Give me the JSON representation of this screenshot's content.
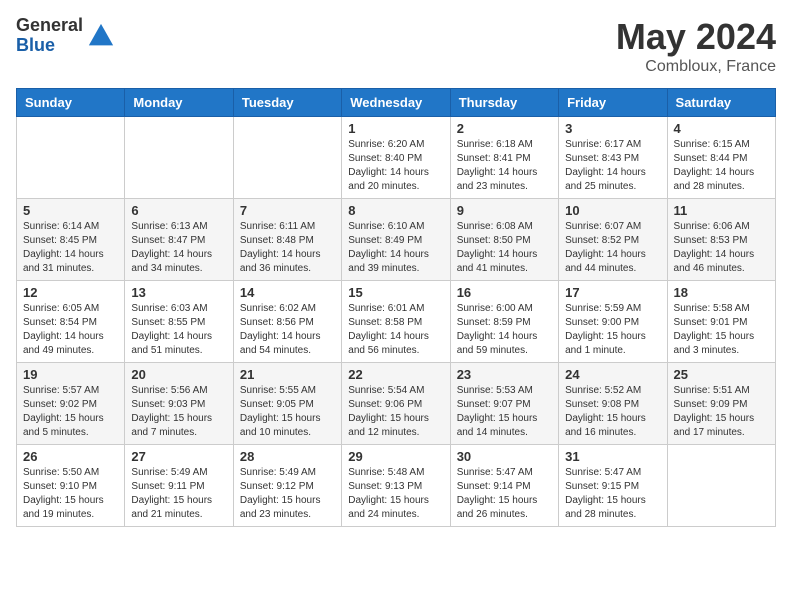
{
  "logo": {
    "general": "General",
    "blue": "Blue"
  },
  "title": "May 2024",
  "location": "Combloux, France",
  "days_of_week": [
    "Sunday",
    "Monday",
    "Tuesday",
    "Wednesday",
    "Thursday",
    "Friday",
    "Saturday"
  ],
  "weeks": [
    [
      {
        "day": "",
        "info": ""
      },
      {
        "day": "",
        "info": ""
      },
      {
        "day": "",
        "info": ""
      },
      {
        "day": "1",
        "info": "Sunrise: 6:20 AM\nSunset: 8:40 PM\nDaylight: 14 hours\nand 20 minutes."
      },
      {
        "day": "2",
        "info": "Sunrise: 6:18 AM\nSunset: 8:41 PM\nDaylight: 14 hours\nand 23 minutes."
      },
      {
        "day": "3",
        "info": "Sunrise: 6:17 AM\nSunset: 8:43 PM\nDaylight: 14 hours\nand 25 minutes."
      },
      {
        "day": "4",
        "info": "Sunrise: 6:15 AM\nSunset: 8:44 PM\nDaylight: 14 hours\nand 28 minutes."
      }
    ],
    [
      {
        "day": "5",
        "info": "Sunrise: 6:14 AM\nSunset: 8:45 PM\nDaylight: 14 hours\nand 31 minutes."
      },
      {
        "day": "6",
        "info": "Sunrise: 6:13 AM\nSunset: 8:47 PM\nDaylight: 14 hours\nand 34 minutes."
      },
      {
        "day": "7",
        "info": "Sunrise: 6:11 AM\nSunset: 8:48 PM\nDaylight: 14 hours\nand 36 minutes."
      },
      {
        "day": "8",
        "info": "Sunrise: 6:10 AM\nSunset: 8:49 PM\nDaylight: 14 hours\nand 39 minutes."
      },
      {
        "day": "9",
        "info": "Sunrise: 6:08 AM\nSunset: 8:50 PM\nDaylight: 14 hours\nand 41 minutes."
      },
      {
        "day": "10",
        "info": "Sunrise: 6:07 AM\nSunset: 8:52 PM\nDaylight: 14 hours\nand 44 minutes."
      },
      {
        "day": "11",
        "info": "Sunrise: 6:06 AM\nSunset: 8:53 PM\nDaylight: 14 hours\nand 46 minutes."
      }
    ],
    [
      {
        "day": "12",
        "info": "Sunrise: 6:05 AM\nSunset: 8:54 PM\nDaylight: 14 hours\nand 49 minutes."
      },
      {
        "day": "13",
        "info": "Sunrise: 6:03 AM\nSunset: 8:55 PM\nDaylight: 14 hours\nand 51 minutes."
      },
      {
        "day": "14",
        "info": "Sunrise: 6:02 AM\nSunset: 8:56 PM\nDaylight: 14 hours\nand 54 minutes."
      },
      {
        "day": "15",
        "info": "Sunrise: 6:01 AM\nSunset: 8:58 PM\nDaylight: 14 hours\nand 56 minutes."
      },
      {
        "day": "16",
        "info": "Sunrise: 6:00 AM\nSunset: 8:59 PM\nDaylight: 14 hours\nand 59 minutes."
      },
      {
        "day": "17",
        "info": "Sunrise: 5:59 AM\nSunset: 9:00 PM\nDaylight: 15 hours\nand 1 minute."
      },
      {
        "day": "18",
        "info": "Sunrise: 5:58 AM\nSunset: 9:01 PM\nDaylight: 15 hours\nand 3 minutes."
      }
    ],
    [
      {
        "day": "19",
        "info": "Sunrise: 5:57 AM\nSunset: 9:02 PM\nDaylight: 15 hours\nand 5 minutes."
      },
      {
        "day": "20",
        "info": "Sunrise: 5:56 AM\nSunset: 9:03 PM\nDaylight: 15 hours\nand 7 minutes."
      },
      {
        "day": "21",
        "info": "Sunrise: 5:55 AM\nSunset: 9:05 PM\nDaylight: 15 hours\nand 10 minutes."
      },
      {
        "day": "22",
        "info": "Sunrise: 5:54 AM\nSunset: 9:06 PM\nDaylight: 15 hours\nand 12 minutes."
      },
      {
        "day": "23",
        "info": "Sunrise: 5:53 AM\nSunset: 9:07 PM\nDaylight: 15 hours\nand 14 minutes."
      },
      {
        "day": "24",
        "info": "Sunrise: 5:52 AM\nSunset: 9:08 PM\nDaylight: 15 hours\nand 16 minutes."
      },
      {
        "day": "25",
        "info": "Sunrise: 5:51 AM\nSunset: 9:09 PM\nDaylight: 15 hours\nand 17 minutes."
      }
    ],
    [
      {
        "day": "26",
        "info": "Sunrise: 5:50 AM\nSunset: 9:10 PM\nDaylight: 15 hours\nand 19 minutes."
      },
      {
        "day": "27",
        "info": "Sunrise: 5:49 AM\nSunset: 9:11 PM\nDaylight: 15 hours\nand 21 minutes."
      },
      {
        "day": "28",
        "info": "Sunrise: 5:49 AM\nSunset: 9:12 PM\nDaylight: 15 hours\nand 23 minutes."
      },
      {
        "day": "29",
        "info": "Sunrise: 5:48 AM\nSunset: 9:13 PM\nDaylight: 15 hours\nand 24 minutes."
      },
      {
        "day": "30",
        "info": "Sunrise: 5:47 AM\nSunset: 9:14 PM\nDaylight: 15 hours\nand 26 minutes."
      },
      {
        "day": "31",
        "info": "Sunrise: 5:47 AM\nSunset: 9:15 PM\nDaylight: 15 hours\nand 28 minutes."
      },
      {
        "day": "",
        "info": ""
      }
    ]
  ]
}
